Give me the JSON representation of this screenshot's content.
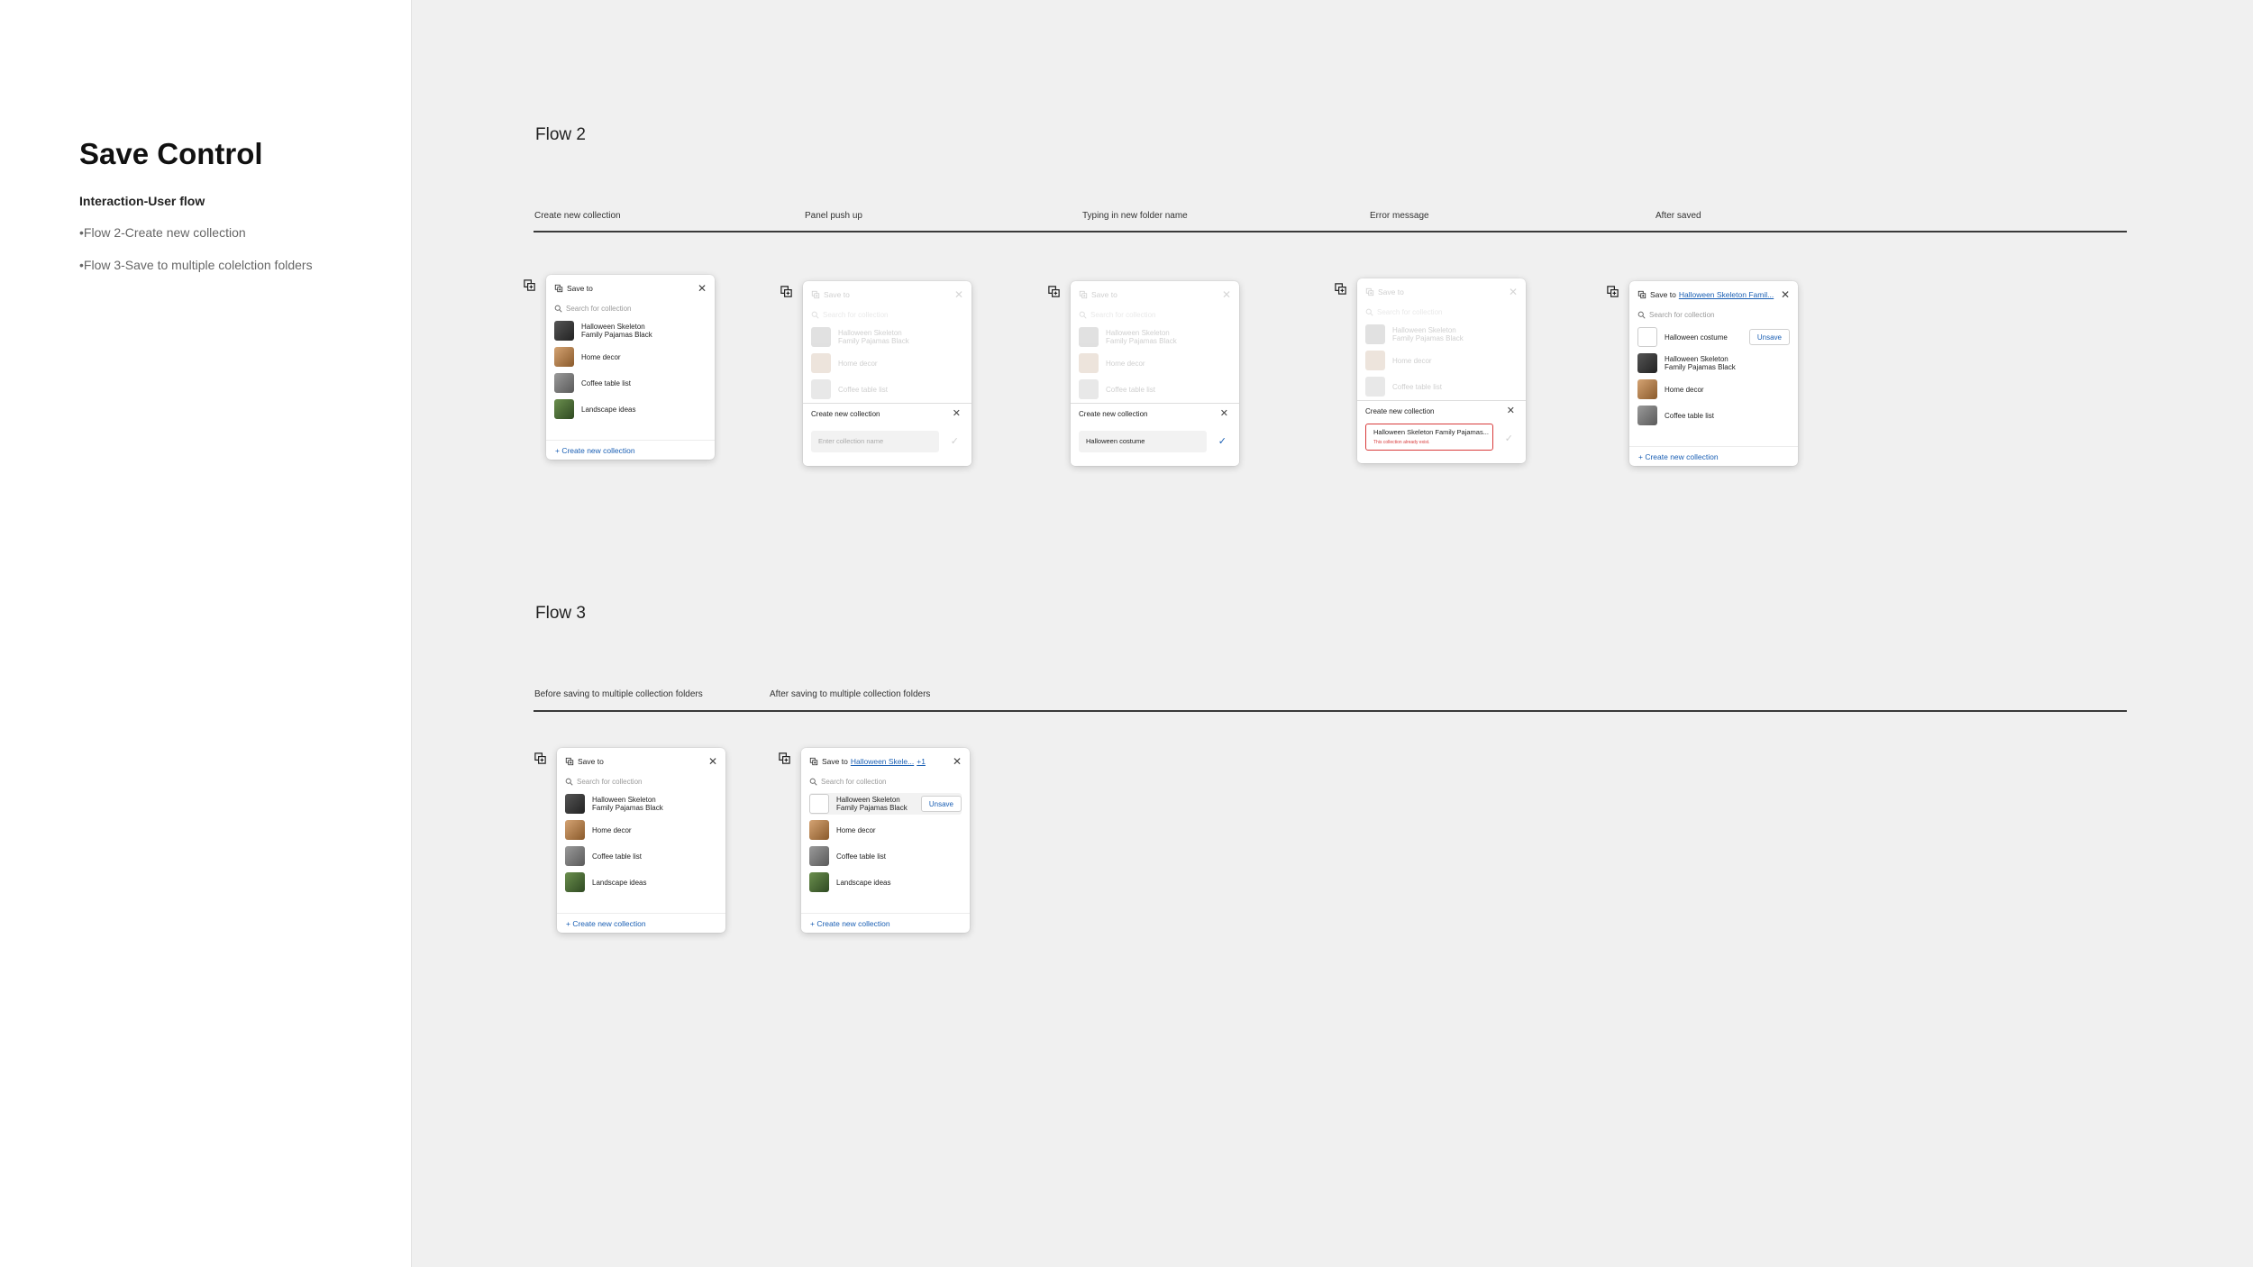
{
  "left": {
    "title": "Save Control",
    "subtitle": "Interaction-User flow",
    "bullets": [
      "•Flow 2-Create new collection",
      "•Flow 3-Save to multiple colelction folders"
    ]
  },
  "flow2": {
    "title": "Flow 2",
    "steps": [
      "Create new collection",
      "Panel push up",
      "Typing in new folder name",
      "Error message",
      "After saved"
    ]
  },
  "flow3": {
    "title": "Flow 3",
    "steps": [
      "Before saving to multiple collection folders",
      "After saving to multiple collection folders"
    ]
  },
  "card": {
    "header": "Save to",
    "search_placeholder": "Search for collection",
    "create_link": "+ Create new collection",
    "unsave": "Unsave",
    "items": [
      {
        "label": "Halloween Skeleton\nFamily Pajamas Black",
        "thumb": "skeleton-thumb"
      },
      {
        "label": "Home decor",
        "thumb": "home-decor-thumb"
      },
      {
        "label": "Coffee table list",
        "thumb": "coffee-table-thumb"
      },
      {
        "label": "Landscape ideas",
        "thumb": "landscape-thumb"
      }
    ],
    "saved_items": [
      {
        "label": "Halloween costume",
        "thumb": "costume-thumb"
      },
      {
        "label": "Halloween Skeleton\nFamily Pajamas Black",
        "thumb": "skeleton-thumb"
      },
      {
        "label": "Home decor",
        "thumb": "home-decor-thumb"
      },
      {
        "label": "Coffee table list",
        "thumb": "coffee-table-thumb"
      }
    ],
    "saved_link": "Halloween Skeleton Famil...",
    "multi_link": "Halloween Skele...",
    "multi_extra": "+1"
  },
  "new_collection": {
    "title": "Create new collection",
    "placeholder": "Enter collection name",
    "typed_value": "Halloween costume",
    "error_value": "Halloween Skeleton Family Pajamas...",
    "error_message": "This collection already exist."
  },
  "colors": {
    "accent": "#1a5fb4",
    "error": "#d83b3b",
    "success": "#1a5fb4"
  }
}
